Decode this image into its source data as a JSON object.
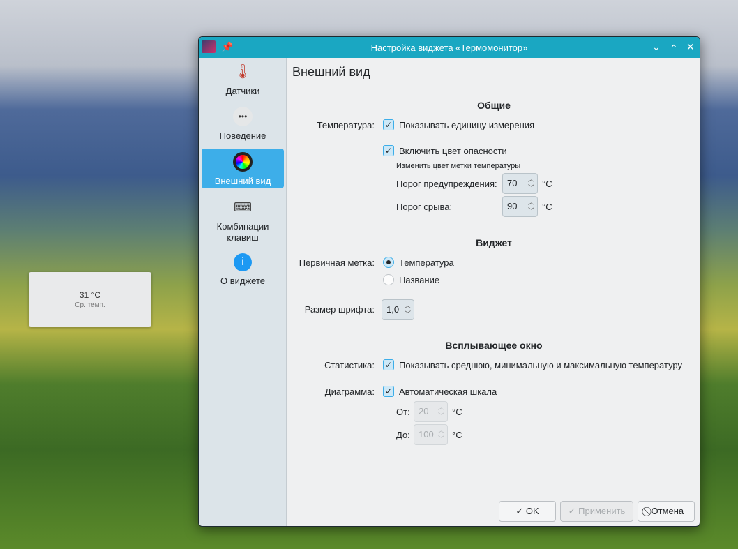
{
  "desktop_widget": {
    "temp": "31 °C",
    "label": "Ср. темп."
  },
  "window": {
    "title": "Настройка виджета «Термомонитор»"
  },
  "sidebar": {
    "items": [
      {
        "label": "Датчики",
        "icon": "thermometer-icon"
      },
      {
        "label": "Поведение",
        "icon": "more-icon"
      },
      {
        "label": "Внешний вид",
        "icon": "color-wheel-icon",
        "active": true
      },
      {
        "label": "Комбинации клавиш",
        "icon": "keyboard-icon"
      },
      {
        "label": "О виджете",
        "icon": "info-icon"
      }
    ]
  },
  "page": {
    "heading": "Внешний вид"
  },
  "general": {
    "title": "Общие",
    "temp_label": "Температура:",
    "show_unit": "Показывать единицу измерения",
    "danger_color": "Включить цвет опасности",
    "hint": "Изменить цвет метки температуры",
    "warn_label": "Порог предупреждения:",
    "warn_value": "70",
    "crit_label": "Порог срыва:",
    "crit_value": "90",
    "unit": "°C"
  },
  "widget": {
    "title": "Виджет",
    "primary_label": "Первичная метка:",
    "opt_temp": "Температура",
    "opt_name": "Название",
    "font_label": "Размер шрифта:",
    "font_value": "1,0"
  },
  "popup": {
    "title": "Всплывающее окно",
    "stats_label": "Статистика:",
    "stats_opt": "Показывать среднюю, минимальную и максимальную температуру",
    "chart_label": "Диаграмма:",
    "auto_scale": "Автоматическая шкала",
    "from_label": "От:",
    "from_value": "20",
    "to_label": "До:",
    "to_value": "100",
    "unit": "°C"
  },
  "buttons": {
    "ok": "✓ OK",
    "apply": "✓ Применить",
    "cancel": "⃠ Отмена"
  }
}
